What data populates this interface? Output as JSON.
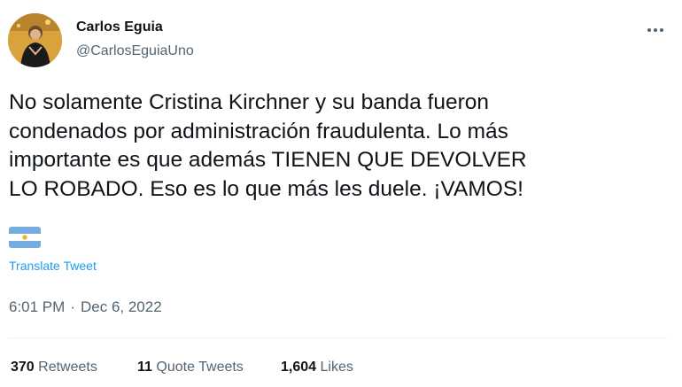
{
  "author": {
    "name": "Carlos Eguia",
    "handle": "@CarlosEguiaUno",
    "avatar_icon": "profile-photo"
  },
  "menu_icon": "more-horizontal-icon",
  "tweet": {
    "text": "No solamente Cristina Kirchner y su banda fueron\ncondenados por administración fraudulenta. Lo más\nimportante es que además TIENEN QUE DEVOLVER\nLO ROBADO. Eso es lo que más les duele. ¡VAMOS!",
    "emoji": "argentina-flag-emoji",
    "translate_label": "Translate Tweet",
    "time": "6:01 PM",
    "separator": "·",
    "date": "Dec 6, 2022"
  },
  "stats": {
    "retweets_count": "370",
    "retweets_label": "Retweets",
    "quotes_count": "11",
    "quotes_label": "Quote Tweets",
    "likes_count": "1,604",
    "likes_label": "Likes"
  },
  "colors": {
    "text": "#0f1419",
    "secondary": "#536471",
    "link": "#1d9bf0",
    "divider": "#eff3f4"
  }
}
